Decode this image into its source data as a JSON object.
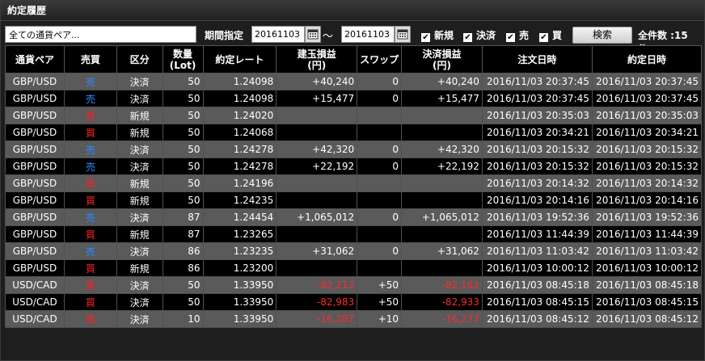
{
  "window": {
    "title": "約定履歴"
  },
  "filters": {
    "pair_placeholder": "全ての通貨ペア...",
    "period_label": "期間指定",
    "date_from": "20161103",
    "date_to": "20161103",
    "tilde": "～",
    "checkboxes": [
      {
        "label": "新規",
        "checked": true
      },
      {
        "label": "決済",
        "checked": true
      },
      {
        "label": "売",
        "checked": true
      },
      {
        "label": "買",
        "checked": true
      }
    ],
    "check_mark": "✔",
    "search_label": "検索",
    "total_text": "全件数 :15 件"
  },
  "table": {
    "headers": [
      "通貨ペア",
      "売買",
      "区分",
      "数量\n(Lot)",
      "約定レート",
      "建玉損益\n(円)",
      "スワップ",
      "決済損益\n(円)",
      "注文日時",
      "約定日時"
    ],
    "rows": [
      [
        "GBP/USD",
        "売",
        "決済",
        "50",
        "1.24098",
        "+40,240",
        "0",
        "+40,240",
        "2016/11/03 20:37:45",
        "2016/11/03 20:37:45"
      ],
      [
        "GBP/USD",
        "売",
        "決済",
        "50",
        "1.24098",
        "+15,477",
        "0",
        "+15,477",
        "2016/11/03 20:37:45",
        "2016/11/03 20:37:45"
      ],
      [
        "GBP/USD",
        "買",
        "新規",
        "50",
        "1.24020",
        "",
        "",
        "",
        "2016/11/03 20:35:03",
        "2016/11/03 20:35:03"
      ],
      [
        "GBP/USD",
        "買",
        "新規",
        "50",
        "1.24068",
        "",
        "",
        "",
        "2016/11/03 20:34:21",
        "2016/11/03 20:34:21"
      ],
      [
        "GBP/USD",
        "売",
        "決済",
        "50",
        "1.24278",
        "+42,320",
        "0",
        "+42,320",
        "2016/11/03 20:15:32",
        "2016/11/03 20:15:32"
      ],
      [
        "GBP/USD",
        "売",
        "決済",
        "50",
        "1.24278",
        "+22,192",
        "0",
        "+22,192",
        "2016/11/03 20:15:32",
        "2016/11/03 20:15:32"
      ],
      [
        "GBP/USD",
        "買",
        "新規",
        "50",
        "1.24196",
        "",
        "",
        "",
        "2016/11/03 20:14:32",
        "2016/11/03 20:14:32"
      ],
      [
        "GBP/USD",
        "買",
        "新規",
        "50",
        "1.24235",
        "",
        "",
        "",
        "2016/11/03 20:14:16",
        "2016/11/03 20:14:16"
      ],
      [
        "GBP/USD",
        "売",
        "決済",
        "87",
        "1.24454",
        "+1,065,012",
        "0",
        "+1,065,012",
        "2016/11/03 19:52:36",
        "2016/11/03 19:52:36"
      ],
      [
        "GBP/USD",
        "買",
        "新規",
        "87",
        "1.23265",
        "",
        "",
        "",
        "2016/11/03 11:44:39",
        "2016/11/03 11:44:39"
      ],
      [
        "GBP/USD",
        "売",
        "決済",
        "86",
        "1.23235",
        "+31,062",
        "0",
        "+31,062",
        "2016/11/03 11:03:42",
        "2016/11/03 11:03:42"
      ],
      [
        "GBP/USD",
        "買",
        "新規",
        "86",
        "1.23200",
        "",
        "",
        "",
        "2016/11/03 10:00:12",
        "2016/11/03 10:00:12"
      ],
      [
        "USD/CAD",
        "買",
        "決済",
        "50",
        "1.33950",
        "-82,212",
        "+50",
        "-82,162",
        "2016/11/03 08:45:18",
        "2016/11/03 08:45:18"
      ],
      [
        "USD/CAD",
        "買",
        "決済",
        "50",
        "1.33950",
        "-82,983",
        "+50",
        "-82,933",
        "2016/11/03 08:45:15",
        "2016/11/03 08:45:15"
      ],
      [
        "USD/CAD",
        "買",
        "決済",
        "10",
        "1.33950",
        "-16,287",
        "+10",
        "-16,277",
        "2016/11/03 08:45:12",
        "2016/11/03 08:45:12"
      ]
    ]
  },
  "colors": {
    "sell": "#2b8bff",
    "buy": "#ff2020",
    "negative": "#ff2a2a"
  }
}
